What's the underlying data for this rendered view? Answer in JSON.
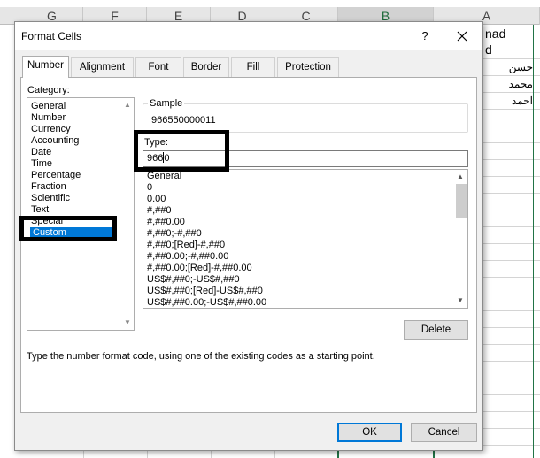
{
  "sheet": {
    "columns": [
      "G",
      "F",
      "E",
      "D",
      "C",
      "B",
      "A"
    ],
    "selected_column": "B",
    "cells": {
      "a1_partial": "nad",
      "a2_partial": "d",
      "a3": "حسن",
      "a4": "محمد",
      "a5": "احمد"
    }
  },
  "dialog": {
    "title": "Format Cells",
    "help_glyph": "?",
    "tabs": [
      "Number",
      "Alignment",
      "Font",
      "Border",
      "Fill",
      "Protection"
    ],
    "active_tab": "Number",
    "category_label": "Category:",
    "categories": [
      "General",
      "Number",
      "Currency",
      "Accounting",
      "Date",
      "Time",
      "Percentage",
      "Fraction",
      "Scientific",
      "Text",
      "Special",
      "Custom"
    ],
    "selected_category": "Custom",
    "sample_label": "Sample",
    "sample_value": "966550000011",
    "type_label": "Type:",
    "type_value_before_caret": "966",
    "type_value_after_caret": "0",
    "format_codes": [
      "General",
      "0",
      "0.00",
      "#,##0",
      "#,##0.00",
      "#,##0;-#,##0",
      "#,##0;[Red]-#,##0",
      "#,##0.00;-#,##0.00",
      "#,##0.00;[Red]-#,##0.00",
      "US$#,##0;-US$#,##0",
      "US$#,##0;[Red]-US$#,##0",
      "US$#,##0.00;-US$#,##0.00"
    ],
    "delete_button": "Delete",
    "hint_text": "Type the number format code, using one of the existing codes as a starting point.",
    "ok_button": "OK",
    "cancel_button": "Cancel"
  },
  "colors": {
    "selection_blue": "#0078d7",
    "excel_green": "#217346",
    "annotation_black": "#000000"
  }
}
